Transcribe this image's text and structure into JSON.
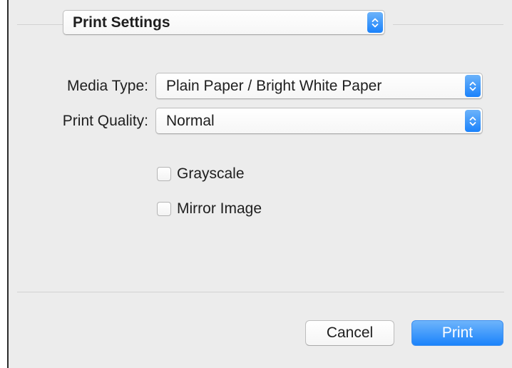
{
  "panel_menu": {
    "selected": "Print Settings"
  },
  "media_type": {
    "label": "Media Type:",
    "selected": "Plain Paper / Bright White Paper"
  },
  "print_quality": {
    "label": "Print Quality:",
    "selected": "Normal"
  },
  "options": {
    "grayscale": {
      "label": "Grayscale",
      "checked": false
    },
    "mirror_image": {
      "label": "Mirror Image",
      "checked": false
    }
  },
  "buttons": {
    "cancel_label": "Cancel",
    "print_label": "Print"
  },
  "colors": {
    "accent": "#1a82fb",
    "dialog_background": "#ececec"
  },
  "icons": {
    "popup_stepper": "up-down-chevron-icon"
  }
}
